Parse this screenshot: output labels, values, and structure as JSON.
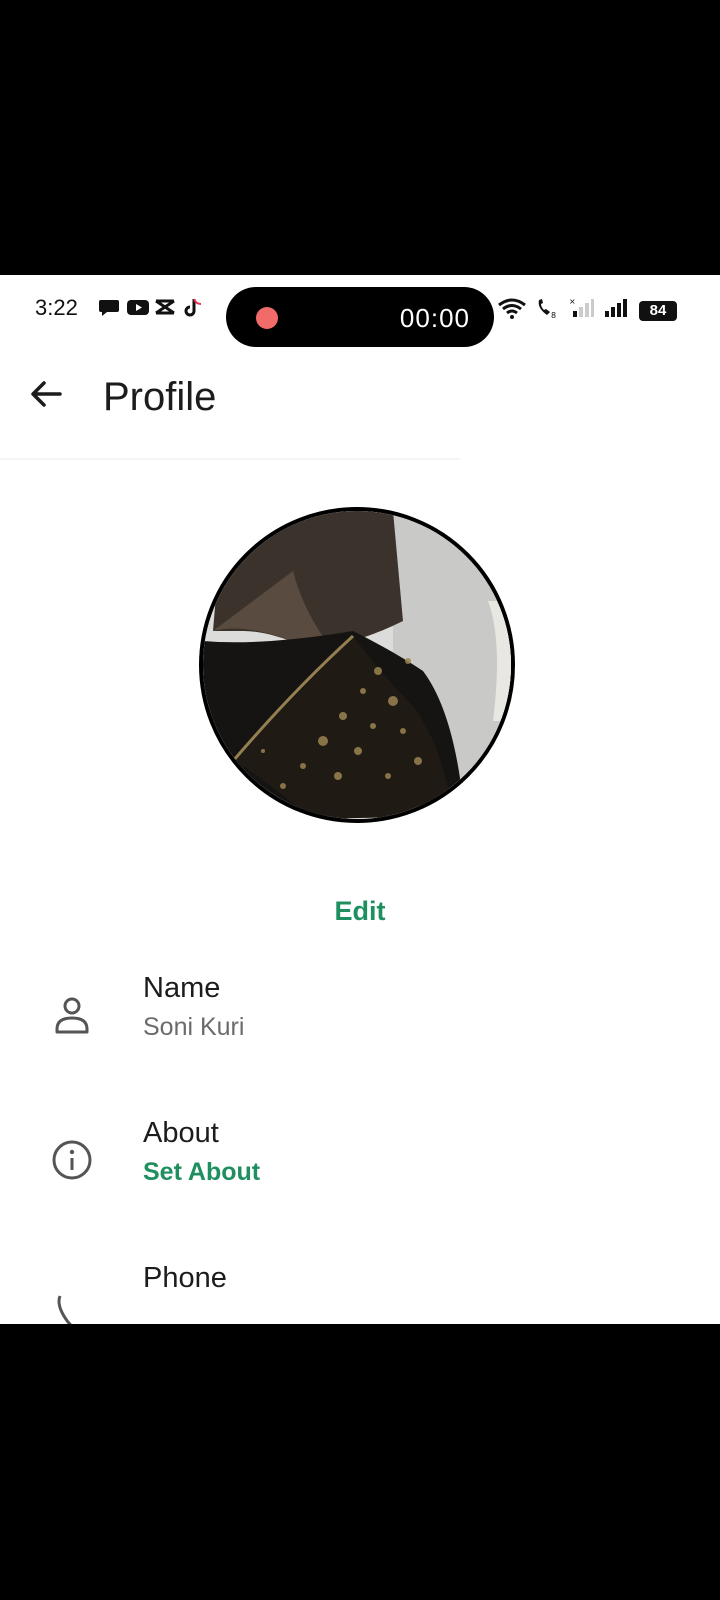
{
  "status_bar": {
    "time": "3:22",
    "recording_timer": "00:00",
    "battery": "84",
    "notification_icons": [
      "chat-bubble-icon",
      "youtube-icon",
      "capcut-icon",
      "tiktok-icon"
    ],
    "system_icons": [
      "wifi-icon",
      "wifi-calling-icon",
      "signal-weak-icon",
      "signal-icon"
    ]
  },
  "app_bar": {
    "title": "Profile"
  },
  "profile": {
    "edit_label": "Edit"
  },
  "rows": {
    "name": {
      "title": "Name",
      "value": "Soni Kuri"
    },
    "about": {
      "title": "About",
      "value": "Set About"
    },
    "phone": {
      "title": "Phone"
    }
  },
  "colors": {
    "accent": "#1f8f5f",
    "record_dot": "#f26b6b",
    "background": "#ffffff"
  }
}
